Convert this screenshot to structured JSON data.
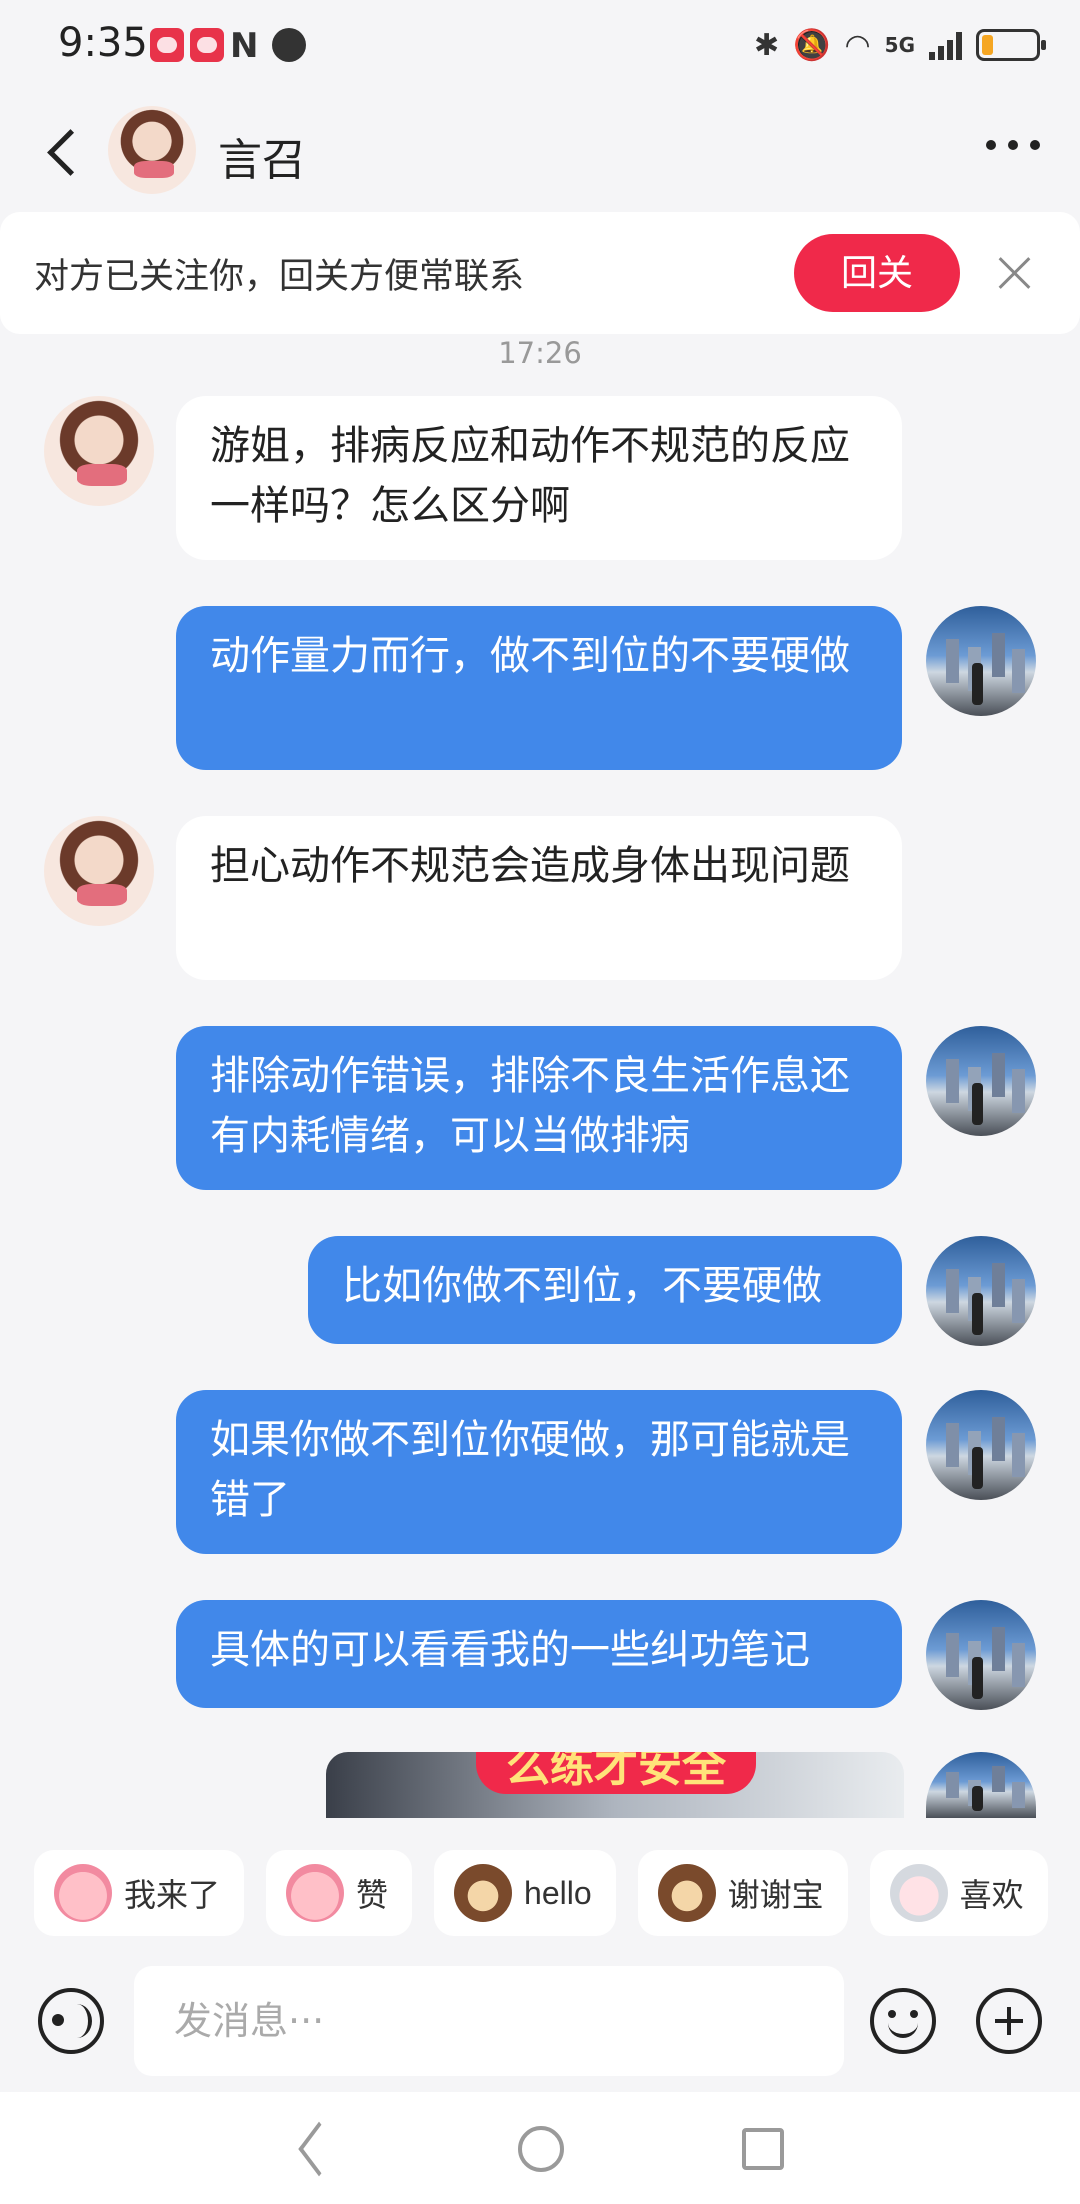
{
  "status_bar": {
    "time": "9:35",
    "nfc": "N",
    "network": "5G",
    "battery_level": 0.22,
    "battery_color": "#f5a623"
  },
  "header": {
    "contact_name": "言召",
    "back_icon": "chevron-left-icon",
    "more_icon": "more-horizontal-icon"
  },
  "follow_banner": {
    "text": "对方已关注你，回关方便常联系",
    "button_label": "回关",
    "button_color": "#f0294a"
  },
  "chat": {
    "timestamp": "17:26",
    "messages": [
      {
        "from": "contact",
        "text": "游姐，排病反应和动作不规范的反应一样吗？怎么区分啊"
      },
      {
        "from": "me",
        "text": "动作量力而行，做不到位的不要硬做"
      },
      {
        "from": "contact",
        "text": "担心动作不规范会造成身体出现问题"
      },
      {
        "from": "me",
        "text": "排除动作错误，排除不良生活作息还有内耗情绪，可以当做排病"
      },
      {
        "from": "me",
        "text": "比如你做不到位，不要硬做"
      },
      {
        "from": "me",
        "text": "如果你做不到位你硬做，那可能就是错了"
      },
      {
        "from": "me",
        "text": "具体的可以看看我的一些纠功笔记"
      }
    ],
    "image_message_caption": "么练才安全",
    "my_bubble_color": "#4188ea"
  },
  "quick_stickers": [
    {
      "label": "我来了",
      "icon": "pig-sticker-icon"
    },
    {
      "label": "赞",
      "icon": "pig-sticker-icon"
    },
    {
      "label": "hello",
      "icon": "monkey-sticker-icon"
    },
    {
      "label": "谢谢宝",
      "icon": "monkey-sticker-icon"
    },
    {
      "label": "喜欢",
      "icon": "sheep-sticker-icon"
    }
  ],
  "composer": {
    "placeholder": "发消息···"
  }
}
